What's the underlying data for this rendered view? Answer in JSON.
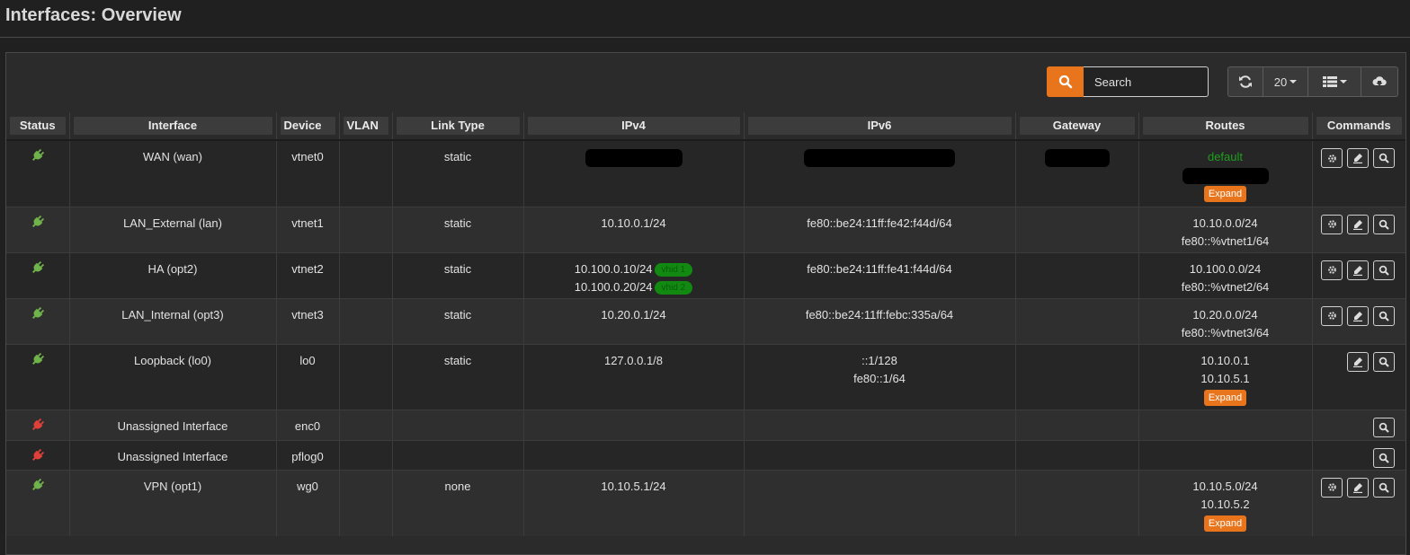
{
  "page": {
    "title": "Interfaces: Overview"
  },
  "toolbar": {
    "search_icon": "search-icon",
    "search_placeholder": "Search",
    "refresh_icon": "refresh-icon",
    "page_size": "20",
    "columns_icon": "columns-icon",
    "export_icon": "cloud-download-icon",
    "accent_color": "#e8741c"
  },
  "columns": [
    "Status",
    "Interface",
    "Device",
    "VLAN",
    "Link Type",
    "IPv4",
    "IPv6",
    "Gateway",
    "Routes",
    "Commands"
  ],
  "rows": [
    {
      "status": "up",
      "interface": "WAN (wan)",
      "device": "vtnet0",
      "vlan": "",
      "link_type": "static",
      "ipv4": [],
      "ipv4_redacted": true,
      "ipv6": [],
      "ipv6_redacted": true,
      "gateway_redacted": true,
      "routes": [
        "default"
      ],
      "routes_redacted": true,
      "expand": "Expand",
      "commands": [
        "edit",
        "reload",
        "inspect"
      ]
    },
    {
      "status": "up",
      "interface": "LAN_External (lan)",
      "device": "vtnet1",
      "vlan": "",
      "link_type": "static",
      "ipv4": [
        "10.10.0.1/24"
      ],
      "ipv6": [
        "fe80::be24:11ff:fe42:f44d/64"
      ],
      "routes": [
        "10.10.0.0/24",
        "fe80::%vtnet1/64"
      ],
      "commands": [
        "edit",
        "reload",
        "inspect"
      ]
    },
    {
      "status": "up",
      "interface": "HA (opt2)",
      "device": "vtnet2",
      "vlan": "",
      "link_type": "static",
      "ipv4": [
        "10.100.0.10/24",
        "10.100.0.20/24"
      ],
      "ipv4_badges": [
        "vhid 1",
        "vhid 2"
      ],
      "ipv6": [
        "fe80::be24:11ff:fe41:f44d/64"
      ],
      "routes": [
        "10.100.0.0/24",
        "fe80::%vtnet2/64"
      ],
      "commands": [
        "edit",
        "reload",
        "inspect"
      ]
    },
    {
      "status": "up",
      "interface": "LAN_Internal (opt3)",
      "device": "vtnet3",
      "vlan": "",
      "link_type": "static",
      "ipv4": [
        "10.20.0.1/24"
      ],
      "ipv6": [
        "fe80::be24:11ff:febc:335a/64"
      ],
      "routes": [
        "10.20.0.0/24",
        "fe80::%vtnet3/64"
      ],
      "commands": [
        "edit",
        "reload",
        "inspect"
      ]
    },
    {
      "status": "up",
      "interface": "Loopback (lo0)",
      "device": "lo0",
      "vlan": "",
      "link_type": "static",
      "ipv4": [
        "127.0.0.1/8"
      ],
      "ipv6": [
        "::1/128",
        "fe80::1/64"
      ],
      "routes": [
        "10.10.0.1",
        "10.10.5.1"
      ],
      "expand": "Expand",
      "commands": [
        "reload",
        "inspect"
      ]
    },
    {
      "status": "down",
      "interface": "Unassigned Interface",
      "device": "enc0",
      "vlan": "",
      "link_type": "",
      "ipv4": [],
      "ipv6": [],
      "routes": [],
      "commands": [
        "inspect"
      ]
    },
    {
      "status": "down",
      "interface": "Unassigned Interface",
      "device": "pflog0",
      "vlan": "",
      "link_type": "",
      "ipv4": [],
      "ipv6": [],
      "routes": [],
      "commands": [
        "inspect"
      ]
    },
    {
      "status": "up",
      "interface": "VPN (opt1)",
      "device": "wg0",
      "vlan": "",
      "link_type": "none",
      "ipv4": [
        "10.10.5.1/24"
      ],
      "ipv6": [],
      "routes": [
        "10.10.5.0/24",
        "10.10.5.2"
      ],
      "expand": "Expand",
      "commands": [
        "edit",
        "reload",
        "inspect"
      ]
    }
  ],
  "colors": {
    "status_up": "#6fb34a",
    "status_down": "#e0403a",
    "vhid_badge": "#128a12",
    "default_route": "#1e9e1e"
  }
}
